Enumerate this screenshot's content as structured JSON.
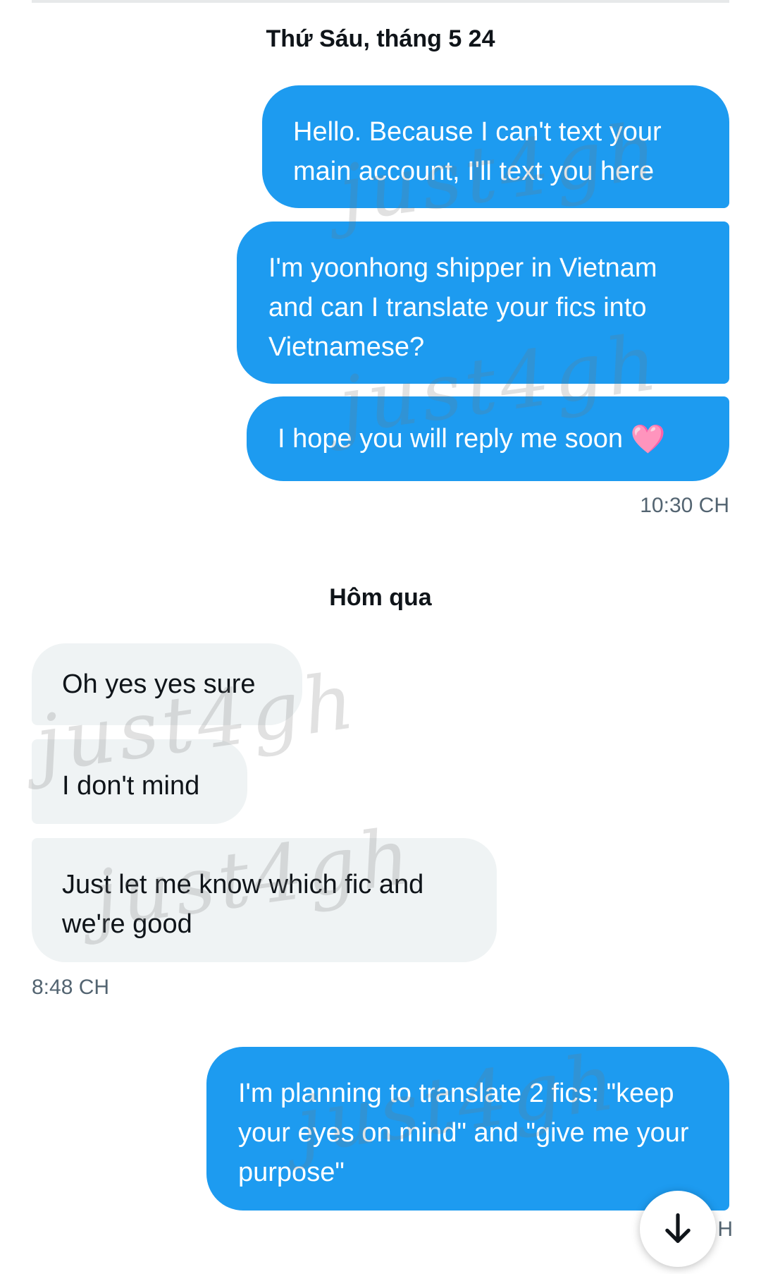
{
  "conversation": {
    "date_separators": {
      "first": "Thứ Sáu, tháng 5 24",
      "second": "Hôm qua"
    },
    "messages": {
      "m1": "Hello. Because I can't text your main account, I'll text you here",
      "m2": "I'm yoonhong shipper in Vietnam and can I translate your fics into Vietnamese?",
      "m3": "I hope you will reply me soon",
      "m3_emoji": "🩷",
      "r1": "Oh yes yes sure",
      "r2": "I don't mind",
      "r3": "Just let me know which fic and we're good",
      "m4": "I'm planning to translate 2 fics: \"keep your eyes on mind\" and \"give me your purpose\""
    },
    "timestamps": {
      "sent_1": "10:30 CH",
      "recv_1": "8:48 CH",
      "sent_2_partial": "H"
    }
  },
  "watermark": {
    "text": "just4gh"
  },
  "scroll_button": {
    "icon": "arrow-down-icon"
  },
  "colors": {
    "sent_bubble": "#1d9bf0",
    "received_bubble": "#eff3f4",
    "text_dark": "#0f1419",
    "timestamp": "#536471"
  }
}
